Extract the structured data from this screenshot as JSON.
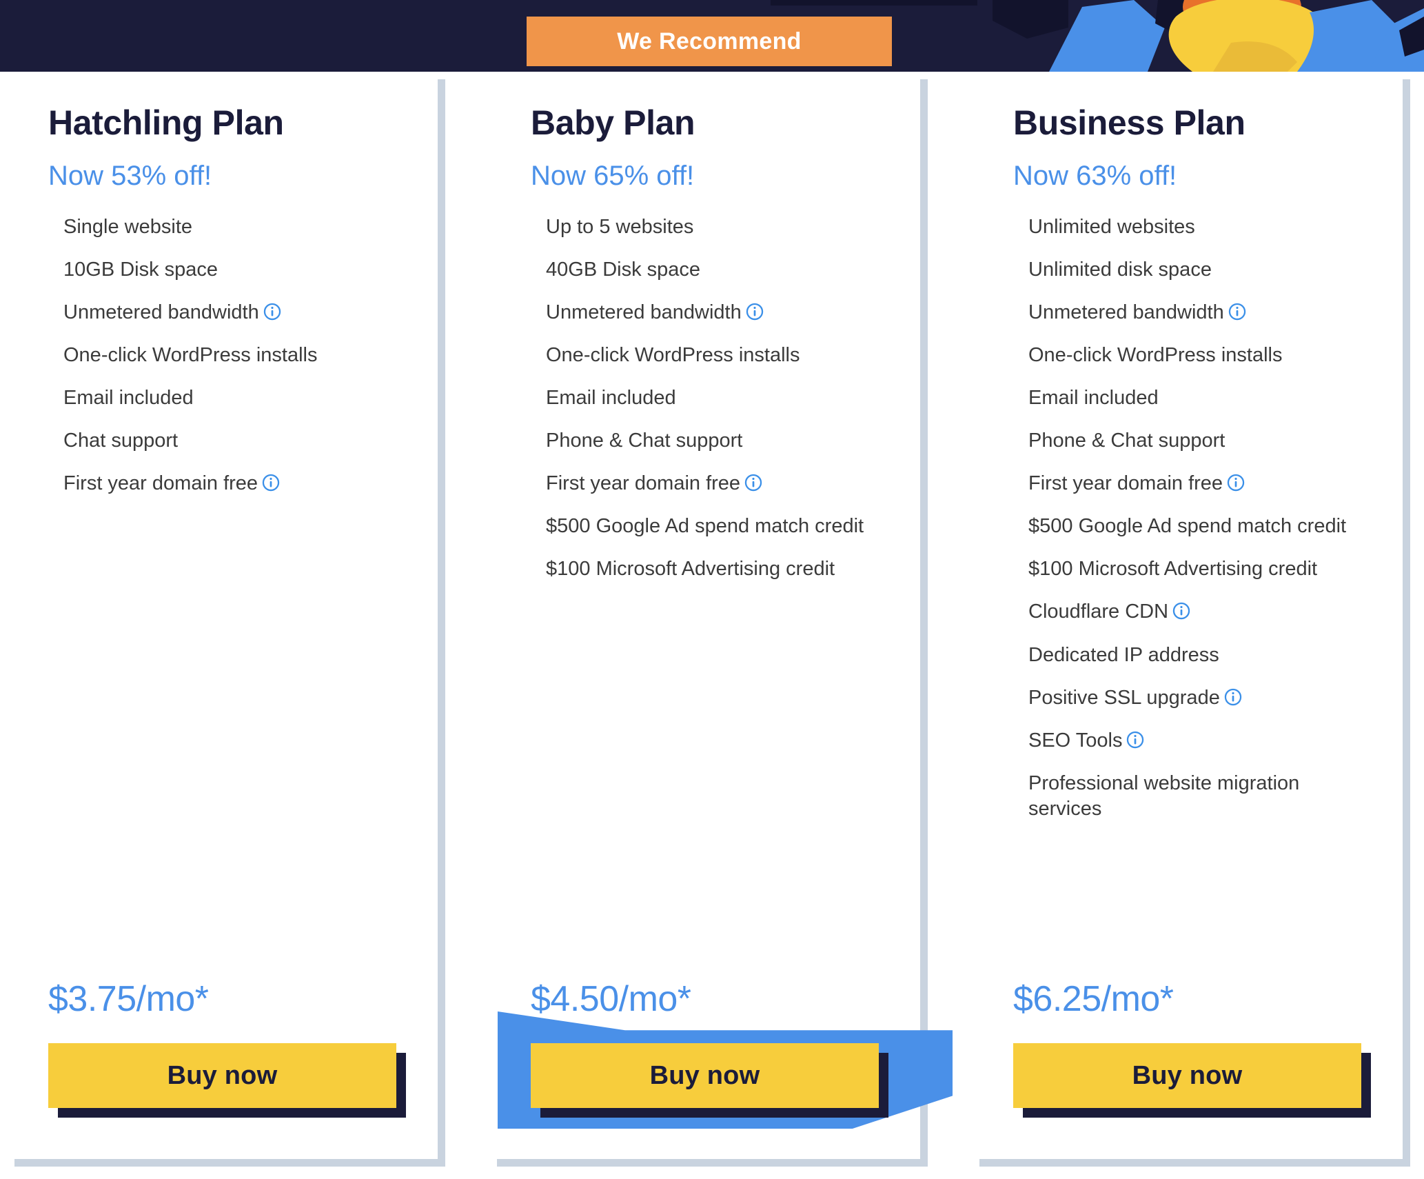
{
  "theme": {
    "dark_navy": "#1b1c3a",
    "accent_blue": "#4a90e8",
    "cta_yellow": "#f7cd3c",
    "ribbon_orange": "#f0954a",
    "card_shadow": "#c9d3df",
    "body_text": "#3b3b3b"
  },
  "ribbon": {
    "label": "We Recommend"
  },
  "plans": [
    {
      "id": "hatchling",
      "title": "Hatchling Plan",
      "discount": "Now 53% off!",
      "price": "$3.75/mo*",
      "cta": "Buy now",
      "recommended": false,
      "features": [
        {
          "text": "Single website",
          "info": false
        },
        {
          "text": "10GB Disk space",
          "info": false
        },
        {
          "text": "Unmetered bandwidth",
          "info": true
        },
        {
          "text": "One-click WordPress installs",
          "info": false
        },
        {
          "text": "Email included",
          "info": false
        },
        {
          "text": "Chat support",
          "info": false
        },
        {
          "text": "First year domain free",
          "info": true
        }
      ]
    },
    {
      "id": "baby",
      "title": "Baby Plan",
      "discount": "Now 65% off!",
      "price": "$4.50/mo*",
      "cta": "Buy now",
      "recommended": true,
      "features": [
        {
          "text": "Up to 5 websites",
          "info": false
        },
        {
          "text": "40GB Disk space",
          "info": false
        },
        {
          "text": "Unmetered bandwidth",
          "info": true
        },
        {
          "text": "One-click WordPress installs",
          "info": false
        },
        {
          "text": "Email included",
          "info": false
        },
        {
          "text": "Phone & Chat support",
          "info": false
        },
        {
          "text": "First year domain free",
          "info": true
        },
        {
          "text": "$500 Google Ad spend match credit",
          "info": false
        },
        {
          "text": "$100 Microsoft Advertising credit",
          "info": false
        }
      ]
    },
    {
      "id": "business",
      "title": "Business Plan",
      "discount": "Now 63% off!",
      "price": "$6.25/mo*",
      "cta": "Buy now",
      "recommended": false,
      "features": [
        {
          "text": "Unlimited websites",
          "info": false
        },
        {
          "text": "Unlimited disk space",
          "info": false
        },
        {
          "text": "Unmetered bandwidth",
          "info": true
        },
        {
          "text": "One-click WordPress installs",
          "info": false
        },
        {
          "text": "Email included",
          "info": false
        },
        {
          "text": "Phone & Chat support",
          "info": false
        },
        {
          "text": "First year domain free",
          "info": true
        },
        {
          "text": "$500 Google Ad spend match credit",
          "info": false
        },
        {
          "text": "$100 Microsoft Advertising credit",
          "info": false
        },
        {
          "text": "Cloudflare CDN",
          "info": true
        },
        {
          "text": "Dedicated IP address",
          "info": false
        },
        {
          "text": "Positive SSL upgrade",
          "info": true
        },
        {
          "text": "SEO Tools",
          "info": true
        },
        {
          "text": "Professional website migration services",
          "info": false
        }
      ]
    }
  ],
  "decoration": {
    "mascot_alt": "mascot-illustration"
  }
}
